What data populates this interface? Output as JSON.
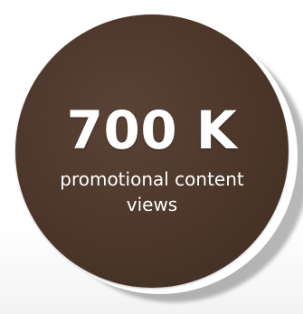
{
  "stat": {
    "value": "700 K",
    "caption": "promotional content views"
  },
  "colors": {
    "disc": "#4b3629",
    "ring": "#ffffff",
    "text": "#ffffff"
  }
}
